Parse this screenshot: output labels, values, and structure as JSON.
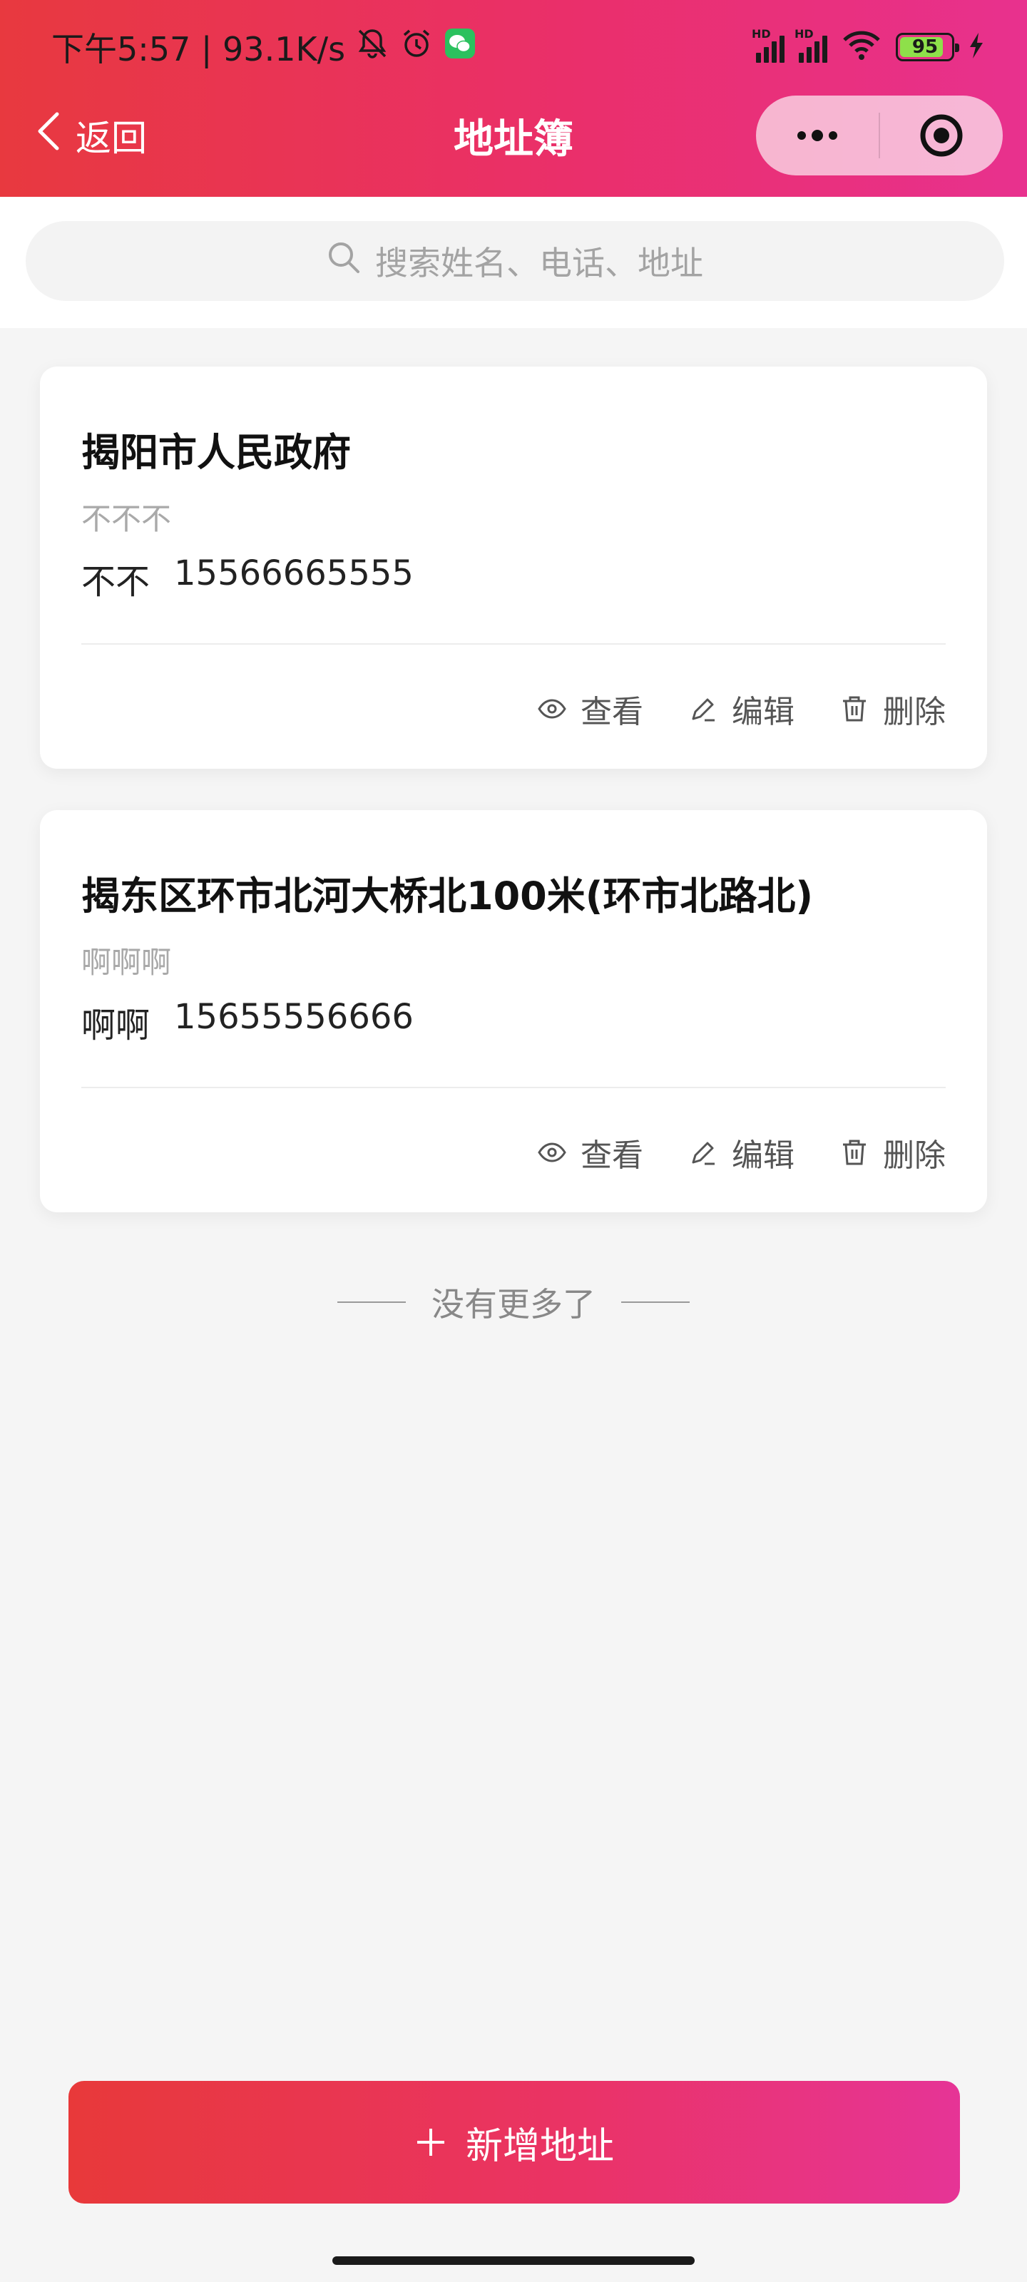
{
  "status_bar": {
    "time_net": "下午5:57 | 93.1K/s",
    "signal_1_label": "HD",
    "signal_2_label": "HD",
    "battery": "95",
    "icons": [
      "mute-bell-icon",
      "alarm-icon",
      "wechat-icon",
      "signal-icon",
      "wifi-icon",
      "battery-icon",
      "charging-icon"
    ]
  },
  "nav": {
    "back_label": "返回",
    "title": "地址簿"
  },
  "search": {
    "placeholder": "搜索姓名、电话、地址"
  },
  "addresses": [
    {
      "title": "揭阳市人民政府",
      "detail": "不不不",
      "name": "不不",
      "phone": "15566665555"
    },
    {
      "title": "揭东区环市北河大桥北100米(环市北路北)",
      "detail": "啊啊啊",
      "name": "啊啊",
      "phone": "15655556666"
    }
  ],
  "actions": {
    "view": "查看",
    "edit": "编辑",
    "delete": "删除"
  },
  "list_end": "没有更多了",
  "add_button": "新增地址",
  "colors": {
    "accent_start": "#e8393f",
    "accent_end": "#e8318e"
  }
}
